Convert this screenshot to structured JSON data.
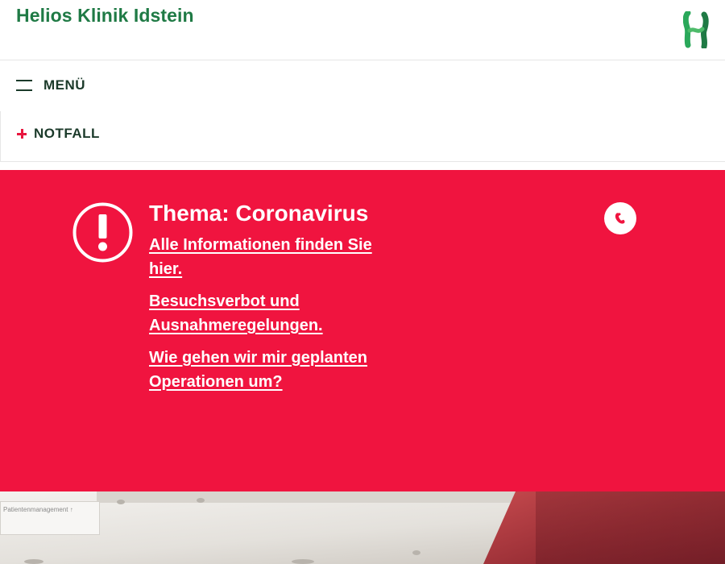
{
  "header": {
    "site_title": "Helios Klinik Idstein",
    "logo_icon": "helios-logo-icon"
  },
  "menu": {
    "label": "MENÜ",
    "icon": "hamburger-icon"
  },
  "notfall": {
    "label": "NOTFALL",
    "icon": "plus-icon"
  },
  "alert": {
    "title": "Thema: Coronavirus",
    "icon": "exclamation-icon",
    "links": [
      "Alle Informationen finden Sie hier.",
      "Besuchsverbot und Ausnahmeregelungen.",
      "Wie gehen wir mir geplanten Operationen um?"
    ],
    "phone_icon": "phone-icon"
  },
  "hero": {
    "sign_text": "Patientenmanagement ↑"
  },
  "colors": {
    "brand_green": "#1f7a45",
    "alert_red": "#f0143f",
    "text_dark": "#1b3a2a"
  }
}
